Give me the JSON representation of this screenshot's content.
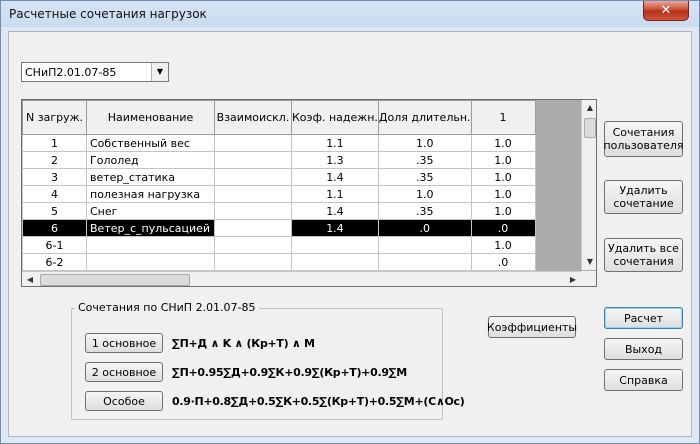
{
  "window": {
    "title": "Расчетные сочетания нагрузок",
    "close_label": "✕"
  },
  "norm_select": {
    "value": "СНиП2.01.07-85"
  },
  "grid": {
    "columns": [
      "N загруж.",
      "Наименование",
      "Взаимоискл.",
      "Коэф. надежн.",
      "Доля длительн.",
      "1"
    ],
    "rows": [
      [
        "1",
        "Собственный вес",
        "",
        "1.1",
        "1.0",
        "1.0"
      ],
      [
        "2",
        "Гололед",
        "",
        "1.3",
        ".35",
        "1.0"
      ],
      [
        "3",
        "ветер_статика",
        "",
        "1.4",
        ".35",
        "1.0"
      ],
      [
        "4",
        "полезная нагрузка",
        "",
        "1.1",
        "1.0",
        "1.0"
      ],
      [
        "5",
        "Снег",
        "",
        "1.4",
        ".35",
        "1.0"
      ],
      [
        "6",
        "Ветер_с_пульсацией",
        "",
        "1.4",
        ".0",
        ".0"
      ],
      [
        "6-1",
        "",
        "",
        "",
        "",
        "1.0"
      ],
      [
        "6-2",
        "",
        "",
        "",
        "",
        ".0"
      ]
    ],
    "selected_row": 5
  },
  "right_buttons": {
    "user_combos": "Сочетания\nпользователя",
    "delete_combo": "Удалить\nсочетание",
    "delete_all": "Удалить все\nсочетания"
  },
  "coefficients_label": "Коэффициенты",
  "action_buttons": {
    "calc": "Расчет",
    "exit": "Выход",
    "help": "Справка"
  },
  "group": {
    "label": "Сочетания по СНиП 2.01.07-85",
    "rows": [
      {
        "button": "1 основное",
        "formula": "∑П+Д ∧ K ∧ (Кр+Т) ∧ М"
      },
      {
        "button": "2 основное",
        "formula": "∑П+0.95∑Д+0.9∑К+0.9∑(Кр+Т)+0.9∑М"
      },
      {
        "button": "Особое",
        "formula": "0.9·П+0.8∑Д+0.5∑К+0.5∑(Кр+Т)+0.5∑М+(С∧Ос)"
      }
    ]
  }
}
